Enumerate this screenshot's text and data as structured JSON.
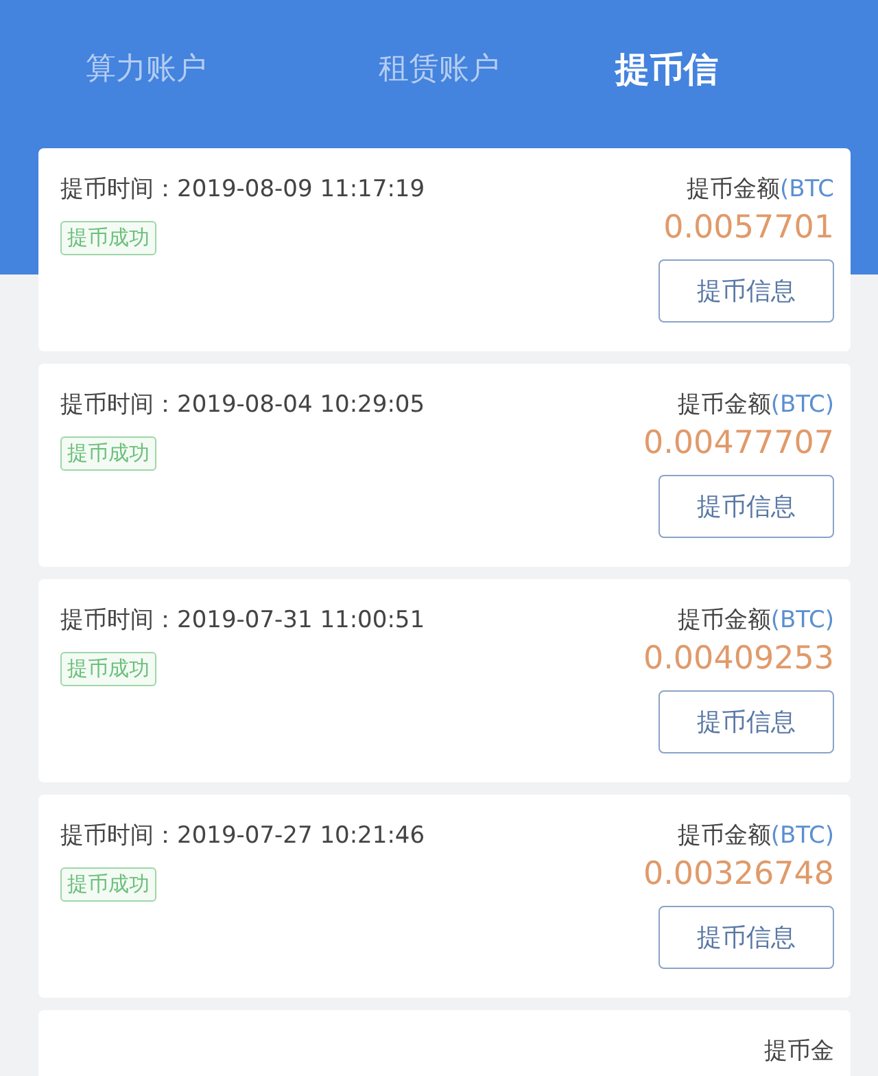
{
  "tabs": [
    {
      "label": "算力账户",
      "selected": false
    },
    {
      "label": "租赁账户",
      "selected": false
    },
    {
      "label": "提币信",
      "selected": true
    }
  ],
  "records": [
    {
      "time_label": "提币时间：",
      "time": "2019-08-09 11:17:19",
      "status": "提币成功",
      "amount_label": "提币金额",
      "unit": "(BTC",
      "amount": "0.0057701",
      "button": "提币信息"
    },
    {
      "time_label": "提币时间：",
      "time": "2019-08-04 10:29:05",
      "status": "提币成功",
      "amount_label": "提币金额",
      "unit": "(BTC)",
      "amount": "0.00477707",
      "button": "提币信息"
    },
    {
      "time_label": "提币时间：",
      "time": "2019-07-31 11:00:51",
      "status": "提币成功",
      "amount_label": "提币金额",
      "unit": "(BTC)",
      "amount": "0.00409253",
      "button": "提币信息"
    },
    {
      "time_label": "提币时间：",
      "time": "2019-07-27 10:21:46",
      "status": "提币成功",
      "amount_label": "提币金额",
      "unit": "(BTC)",
      "amount": "0.00326748",
      "button": "提币信息"
    },
    {
      "amount_label": "提币金"
    }
  ]
}
